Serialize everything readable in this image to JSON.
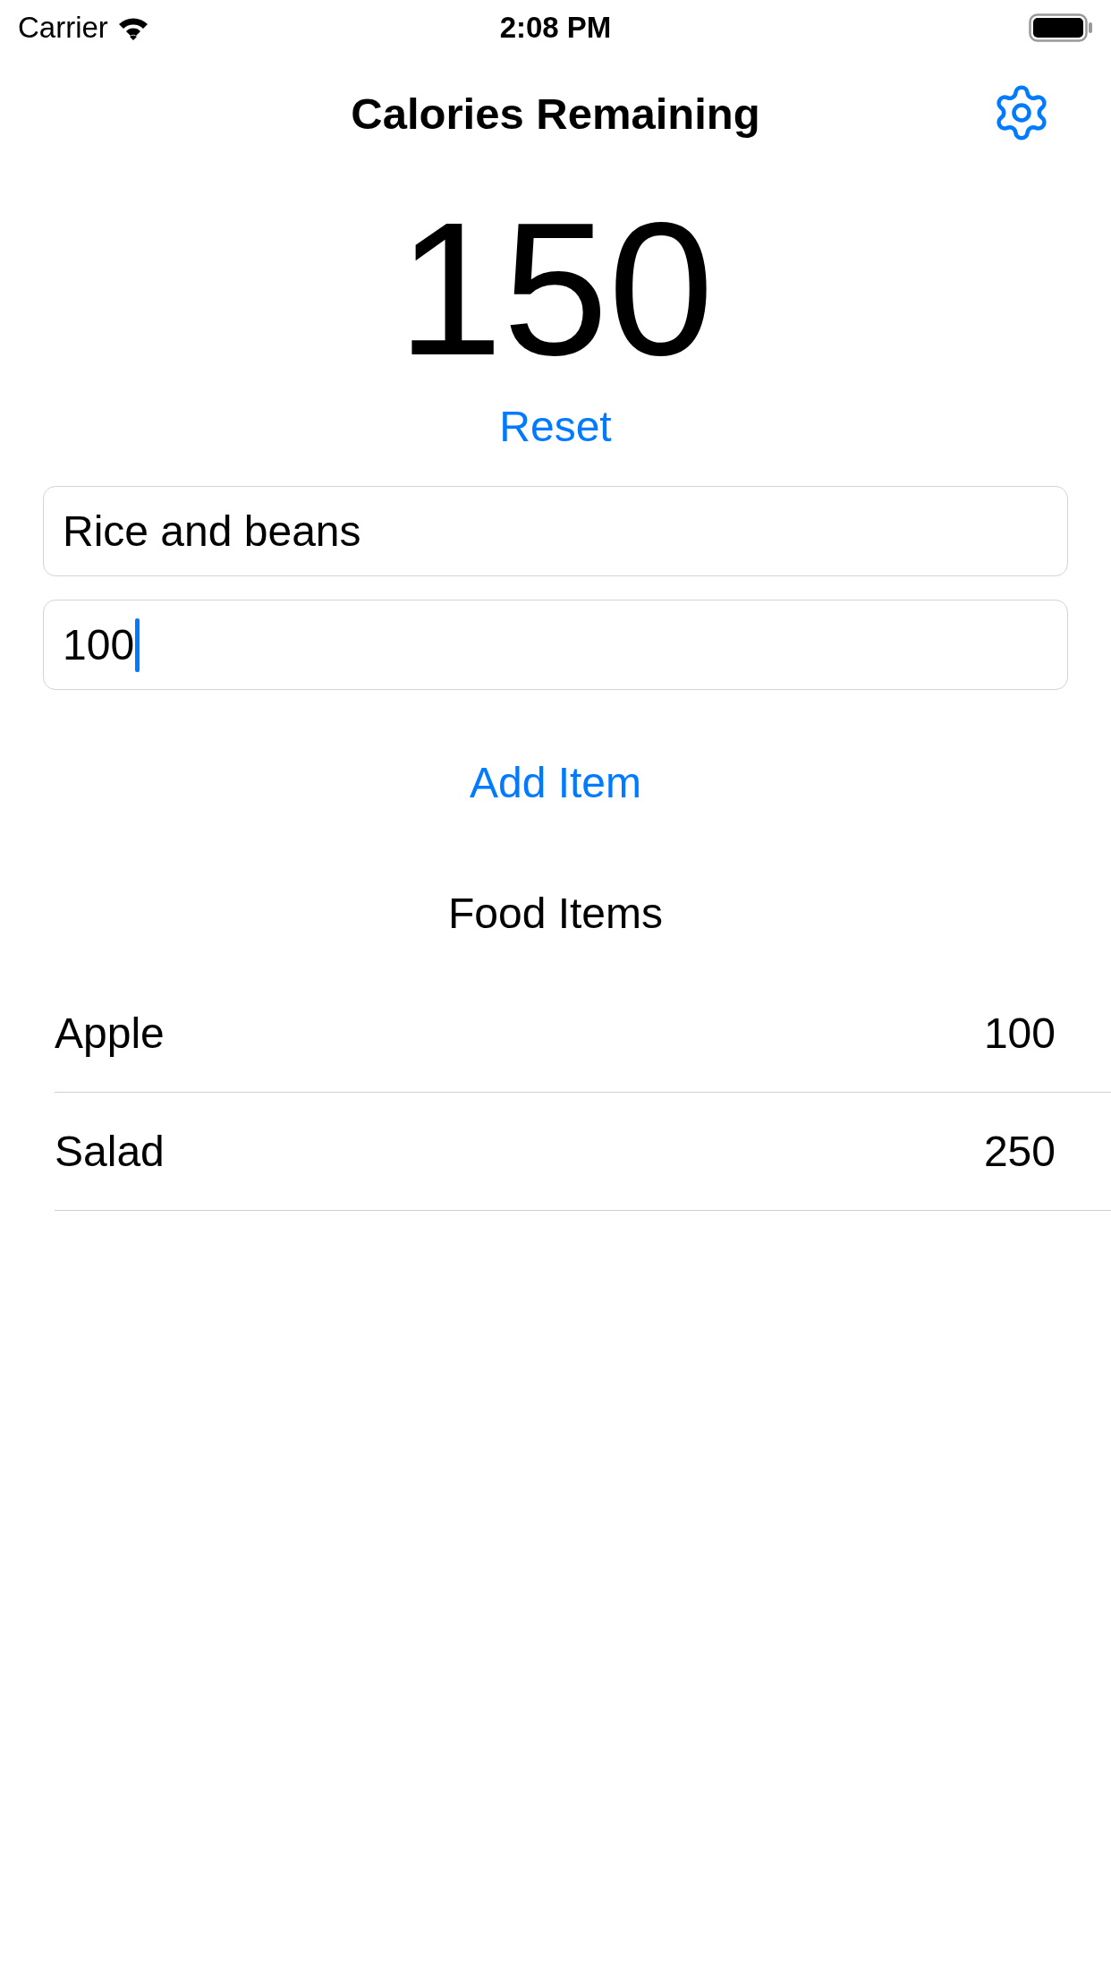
{
  "status_bar": {
    "carrier": "Carrier",
    "time": "2:08 PM"
  },
  "nav_bar": {
    "title": "Calories Remaining"
  },
  "remaining": "150",
  "reset_button": "Reset",
  "fields": [
    {
      "value": "Rice and beans",
      "focused": false
    },
    {
      "value": "100",
      "focused": true
    }
  ],
  "add_button": "Add Item",
  "list": {
    "title": "Food Items",
    "rows": [
      {
        "name": "Apple",
        "calories": "100"
      },
      {
        "name": "Salad",
        "calories": "250"
      }
    ]
  }
}
